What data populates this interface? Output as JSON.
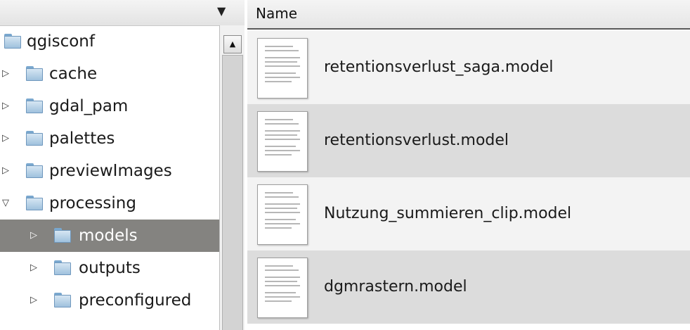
{
  "tree": {
    "rows": [
      {
        "label": "qgisconf",
        "expander": "",
        "selected": false
      },
      {
        "label": "cache",
        "expander": "▷",
        "selected": false
      },
      {
        "label": "gdal_pam",
        "expander": "▷",
        "selected": false
      },
      {
        "label": "palettes",
        "expander": "▷",
        "selected": false
      },
      {
        "label": "previewImages",
        "expander": "▷",
        "selected": false
      },
      {
        "label": "processing",
        "expander": "▽",
        "selected": false
      },
      {
        "label": "models",
        "expander": "▷",
        "selected": true
      },
      {
        "label": "outputs",
        "expander": "▷",
        "selected": false
      },
      {
        "label": "preconfigured",
        "expander": "▷",
        "selected": false
      }
    ],
    "header_arrow": "▼",
    "scroll_up": "▲"
  },
  "list": {
    "header": "Name",
    "files": [
      {
        "name": "retentionsverlust_saga.model"
      },
      {
        "name": "retentionsverlust.model"
      },
      {
        "name": "Nutzung_summieren_clip.model"
      },
      {
        "name": "dgmrastern.model"
      }
    ]
  },
  "icons": {
    "folder": "folder-icon",
    "file": "document-icon"
  },
  "colors": {
    "selection": "#848380",
    "row_alt": "#dcdcdc",
    "folder": "#9fc1dd"
  }
}
